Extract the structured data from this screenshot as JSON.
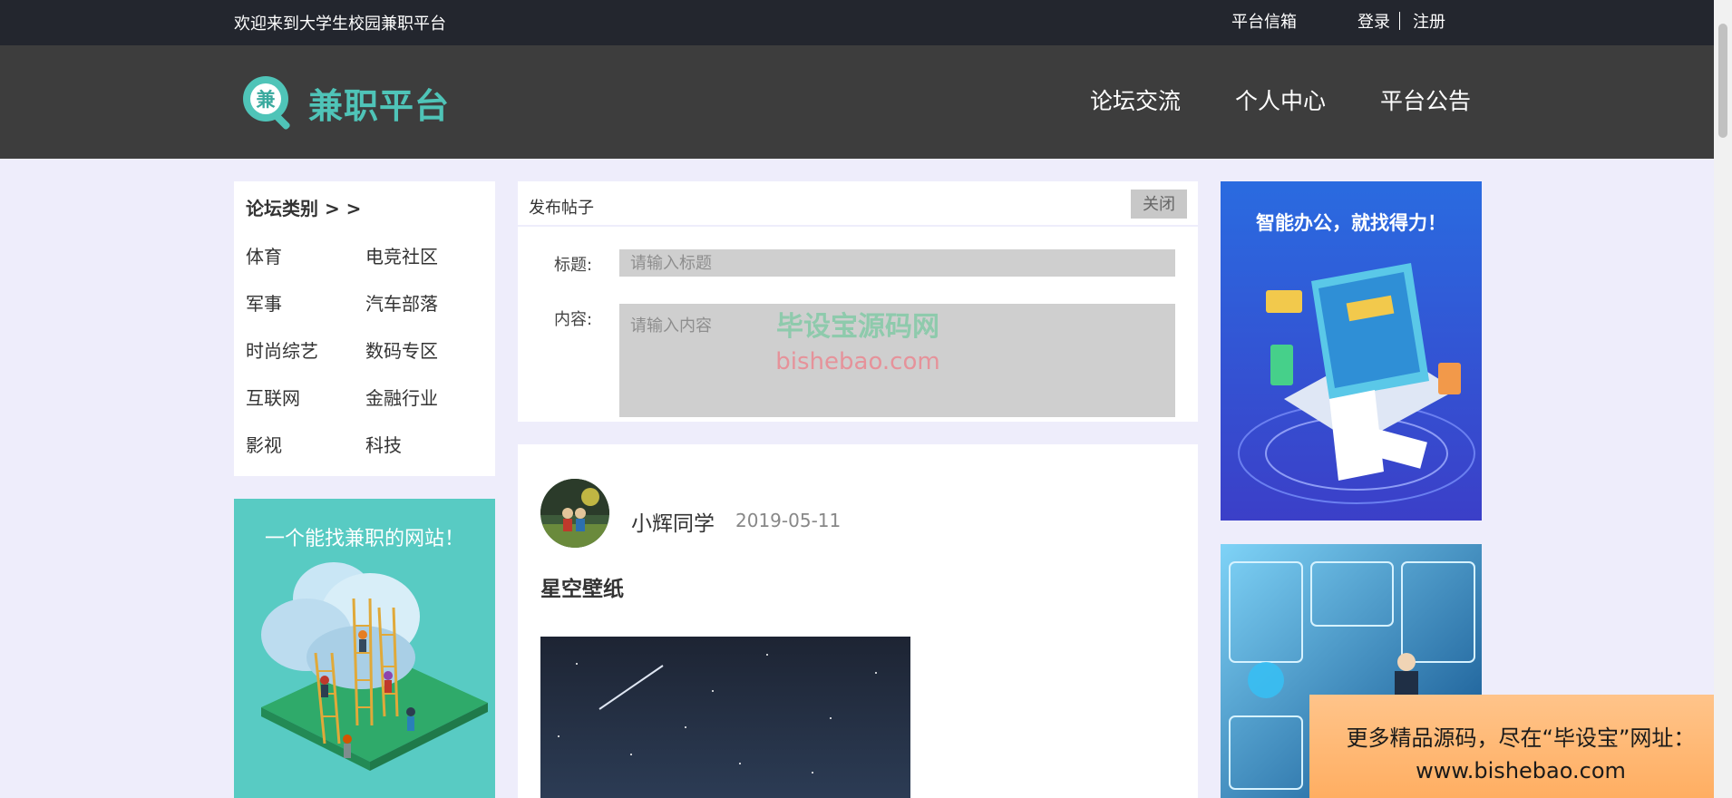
{
  "topbar": {
    "welcome": "欢迎来到大学生校园兼职平台",
    "mailbox": "平台信箱",
    "login": "登录",
    "register": "注册"
  },
  "header": {
    "logo_char": "兼",
    "logo_text": "兼职平台",
    "nav": [
      "论坛交流",
      "个人中心",
      "平台公告"
    ]
  },
  "categories": {
    "title": "论坛类别 > >",
    "items": [
      "体育",
      "电竞社区",
      "军事",
      "汽车部落",
      "时尚综艺",
      "数码专区",
      "互联网",
      "金融行业",
      "影视",
      "科技"
    ]
  },
  "left_ad": {
    "caption": "一个能找兼职的网站！"
  },
  "post_form": {
    "heading": "发布帖子",
    "close_label": "关闭",
    "title_label": "标题:",
    "title_placeholder": "请输入标题",
    "content_label": "内容:",
    "content_placeholder": "请输入内容"
  },
  "watermark": {
    "line1": "毕设宝源码网",
    "line2": "bishebao.com"
  },
  "post": {
    "author": "小辉同学",
    "date": "2019-05-11",
    "title": "星空壁纸"
  },
  "right_ad1": {
    "caption": "智能办公，就找得力！"
  },
  "promo": {
    "line1": "更多精品源码，尽在“毕设宝”网址：",
    "line2": "www.bishebao.com"
  },
  "colors": {
    "topbar": "#23262e",
    "header": "#3d3d3d",
    "accent": "#4fc4b8",
    "page_bg": "#eeedfb"
  }
}
